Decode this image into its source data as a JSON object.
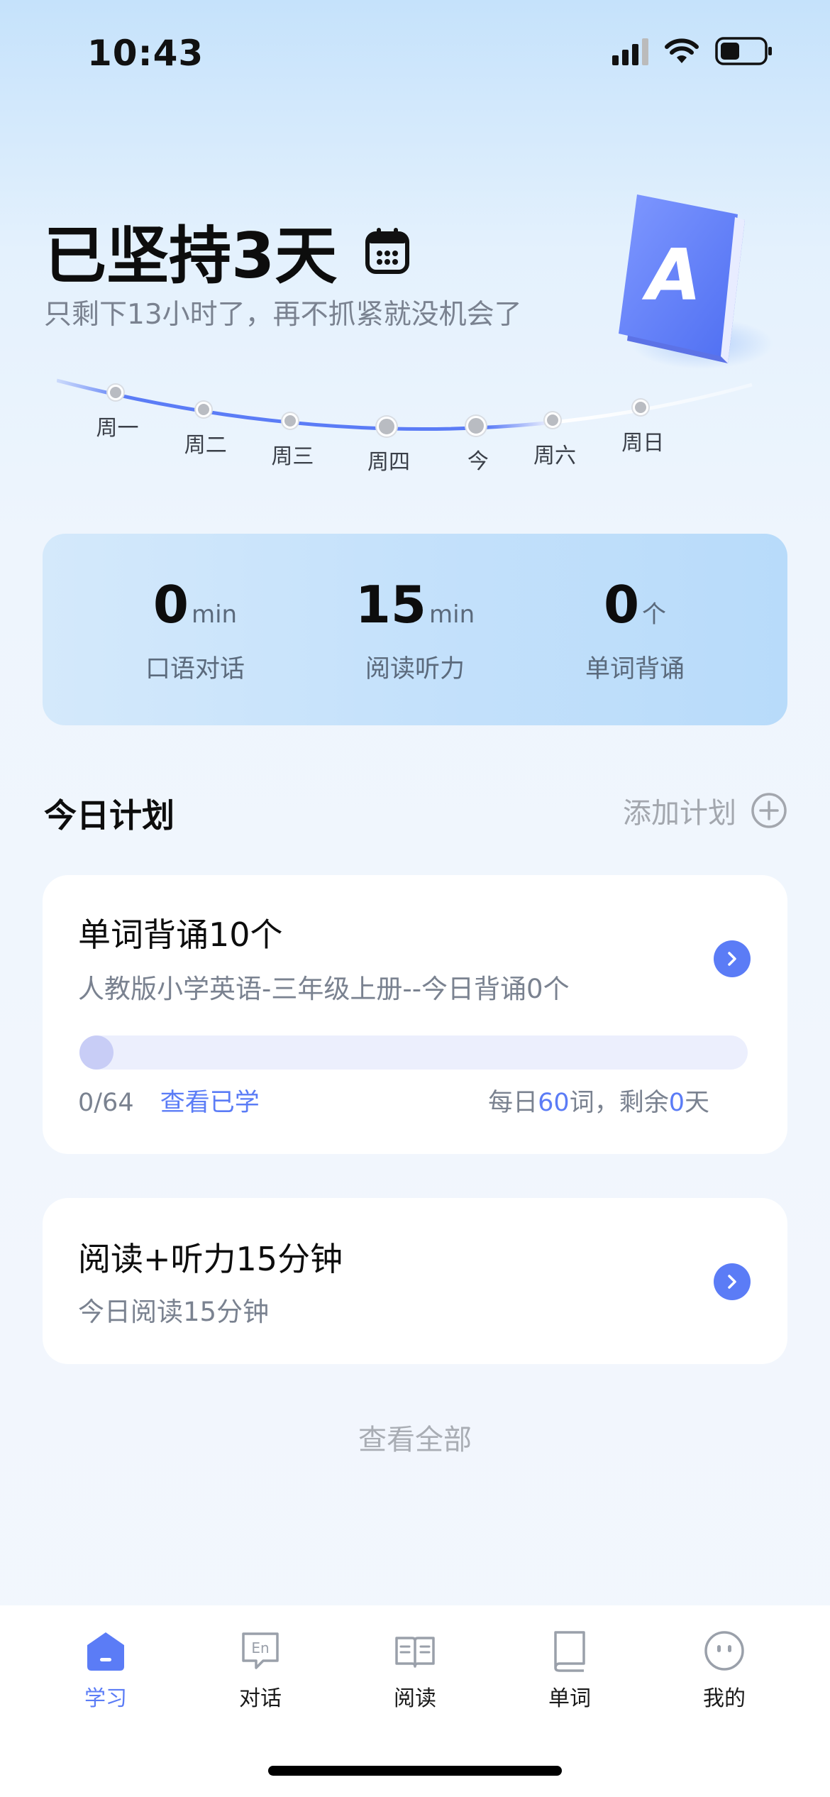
{
  "status_bar": {
    "time": "10:43"
  },
  "header": {
    "title": "已坚持3天",
    "subtitle": "只剩下13小时了，再不抓紧就没机会了",
    "book_letter": "A"
  },
  "week": [
    "周一",
    "周二",
    "周三",
    "周四",
    "今",
    "周六",
    "周日"
  ],
  "stats": [
    {
      "value": "0",
      "unit": "min",
      "label": "口语对话"
    },
    {
      "value": "15",
      "unit": "min",
      "label": "阅读听力"
    },
    {
      "value": "0",
      "unit": "个",
      "label": "单词背诵"
    }
  ],
  "plan": {
    "title": "今日计划",
    "add_label": "添加计划",
    "cards": [
      {
        "title": "单词背诵10个",
        "desc": "人教版小学英语-三年级上册--今日背诵0个",
        "progress_text": "0/64",
        "progress_fraction": 0,
        "link": "查看已学",
        "daily_prefix": "每日",
        "daily_count": "60",
        "daily_mid": "词，剩余",
        "days_left": "0",
        "daily_suffix": "天"
      },
      {
        "title": "阅读+听力15分钟",
        "desc": "今日阅读15分钟"
      }
    ],
    "view_all": "查看全部"
  },
  "tabbar": [
    {
      "label": "学习",
      "icon": "home-icon",
      "active": true
    },
    {
      "label": "对话",
      "icon": "chat-en-icon",
      "active": false
    },
    {
      "label": "阅读",
      "icon": "open-book-icon",
      "active": false
    },
    {
      "label": "单词",
      "icon": "book-icon",
      "active": false
    },
    {
      "label": "我的",
      "icon": "smile-icon",
      "active": false
    }
  ],
  "colors": {
    "accent": "#5b7cf6",
    "muted": "#7a8290"
  }
}
